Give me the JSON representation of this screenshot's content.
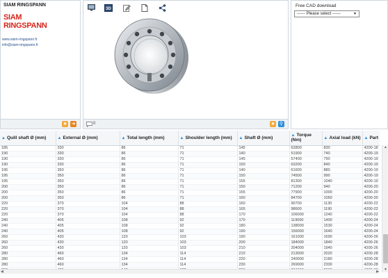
{
  "company": {
    "name": "SIAM RINGSPANN",
    "logo_line1": "SIAM",
    "logo_line2": "RINGSPANN",
    "website": "www.siam-ringspann.fr",
    "email": "info@siam-ringspann.fr",
    "logo_color": "#d6261c"
  },
  "toolbar": {
    "icons": [
      "monitor-icon",
      "3d-icon",
      "edit-icon",
      "document-icon",
      "share-icon"
    ],
    "label_3d": "3D"
  },
  "comments": {
    "count": "0"
  },
  "cad": {
    "title": "Free CAD download",
    "select_value": "------ Please select ------",
    "arrow": "▼"
  },
  "table": {
    "columns": [
      "Quill shaft Ø (mm)",
      "External Ø (mm)",
      "Total length (mm)",
      "Shoulder length (mm)",
      "Shaft Ø (mm)",
      "Torque (Nm)",
      "Axial load (kN)",
      "Part"
    ],
    "rows": [
      [
        "185",
        "330",
        "86",
        "71",
        "145",
        "62800",
        "830",
        "4200-18"
      ],
      [
        "190",
        "330",
        "86",
        "71",
        "140",
        "51900",
        "740",
        "4200-19"
      ],
      [
        "190",
        "330",
        "86",
        "71",
        "145",
        "57400",
        "790",
        "4200-19"
      ],
      [
        "190",
        "330",
        "86",
        "71",
        "150",
        "63200",
        "840",
        "4200-19"
      ],
      [
        "195",
        "350",
        "86",
        "71",
        "140",
        "61600",
        "880",
        "4200-19"
      ],
      [
        "195",
        "350",
        "86",
        "71",
        "150",
        "74500",
        "990",
        "4200-19"
      ],
      [
        "195",
        "350",
        "86",
        "71",
        "155",
        "81300",
        "1040",
        "4200-19"
      ],
      [
        "200",
        "350",
        "86",
        "71",
        "150",
        "71200",
        "940",
        "4200-20"
      ],
      [
        "200",
        "350",
        "86",
        "71",
        "155",
        "77900",
        "1000",
        "4200-20"
      ],
      [
        "200",
        "350",
        "86",
        "71",
        "160",
        "84700",
        "1050",
        "4200-20"
      ],
      [
        "220",
        "370",
        "104",
        "88",
        "160",
        "90700",
        "1130",
        "4200-22"
      ],
      [
        "220",
        "370",
        "104",
        "88",
        "165",
        "98600",
        "1190",
        "4200-22"
      ],
      [
        "220",
        "370",
        "104",
        "88",
        "170",
        "106000",
        "1240",
        "4200-22"
      ],
      [
        "240",
        "405",
        "108",
        "92",
        "170",
        "119000",
        "1400",
        "4200-24"
      ],
      [
        "240",
        "405",
        "108",
        "92",
        "180",
        "138000",
        "1530",
        "4200-24"
      ],
      [
        "240",
        "405",
        "108",
        "92",
        "190",
        "156000",
        "1640",
        "4200-24"
      ],
      [
        "260",
        "430",
        "120",
        "103",
        "190",
        "161000",
        "1690",
        "4200-26"
      ],
      [
        "260",
        "430",
        "120",
        "103",
        "200",
        "184000",
        "1840",
        "4200-26"
      ],
      [
        "260",
        "430",
        "120",
        "103",
        "210",
        "204000",
        "1940",
        "4200-26"
      ],
      [
        "280",
        "460",
        "134",
        "114",
        "210",
        "213000",
        "2020",
        "4200-28"
      ],
      [
        "280",
        "460",
        "134",
        "114",
        "220",
        "240000",
        "2180",
        "4200-28"
      ],
      [
        "280",
        "460",
        "134",
        "114",
        "230",
        "269000",
        "2330",
        "4200-28"
      ],
      [
        "300",
        "485",
        "142",
        "122",
        "230",
        "274000",
        "2380",
        "4200-30"
      ]
    ]
  },
  "colors": {
    "accent_blue": "#2f8fd6",
    "accent_orange": "#e9841f",
    "border": "#cfd6dd"
  }
}
